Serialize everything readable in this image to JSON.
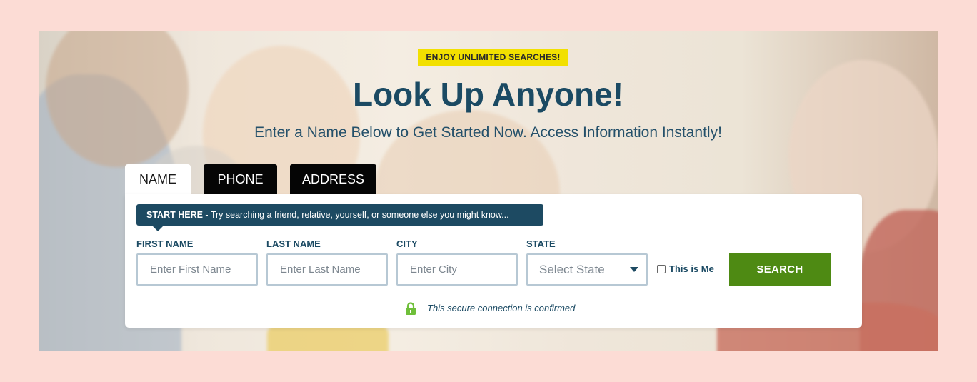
{
  "badge": "ENJOY UNLIMITED SEARCHES!",
  "headline": "Look Up Anyone!",
  "subhead": "Enter a Name Below to Get Started Now. Access Information Instantly!",
  "tabs": [
    {
      "label": "NAME",
      "active": true
    },
    {
      "label": "PHONE",
      "active": false
    },
    {
      "label": "ADDRESS",
      "active": false
    }
  ],
  "tip": {
    "bold": "START HERE",
    "text": " - Try searching a friend, relative, yourself, or someone else you might know..."
  },
  "form": {
    "first_name": {
      "label": "FIRST NAME",
      "placeholder": "Enter First Name"
    },
    "last_name": {
      "label": "LAST NAME",
      "placeholder": "Enter Last Name"
    },
    "city": {
      "label": "CITY",
      "placeholder": "Enter City"
    },
    "state": {
      "label": "STATE",
      "selected": "Select State"
    },
    "this_is_me": "This is Me",
    "search_label": "SEARCH"
  },
  "secure_text": "This secure connection is confirmed",
  "colors": {
    "page_bg": "#fcdcd5",
    "accent_navy": "#1b4a63",
    "badge_yellow": "#f2e000",
    "search_green": "#4e8a13",
    "lock_green": "#6fbf3a"
  },
  "icons": {
    "lock": "lock-icon",
    "dropdown": "chevron-down-icon"
  }
}
